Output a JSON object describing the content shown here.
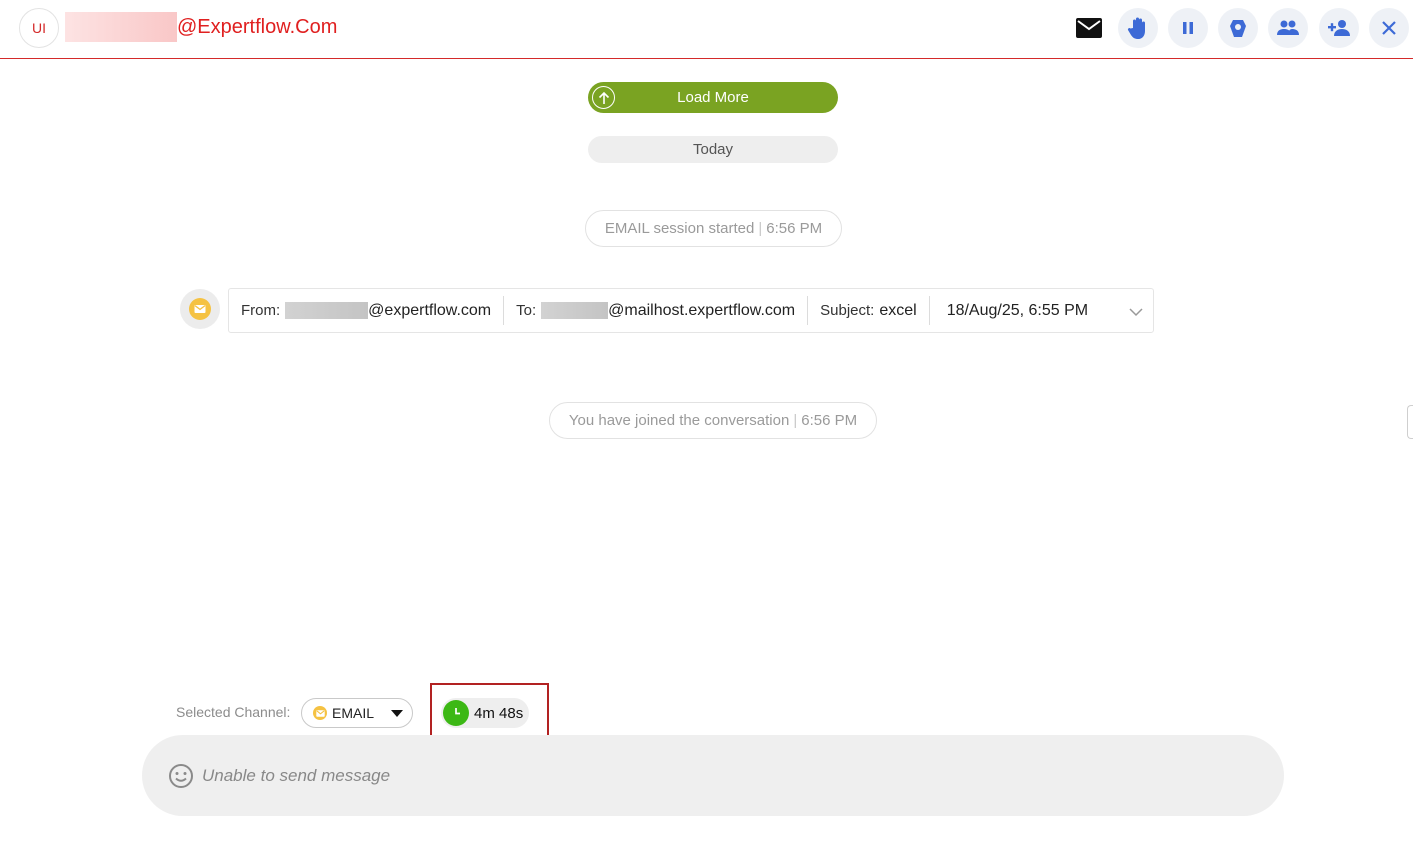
{
  "header": {
    "avatar_initials": "UI",
    "email_domain": "@Expertflow.Com",
    "icons": [
      "envelope-icon",
      "raise-hand-icon",
      "pause-icon",
      "agent-assist-icon",
      "group-icon",
      "add-person-icon",
      "close-icon"
    ],
    "accent_color": "#e02020"
  },
  "conversation": {
    "load_more_label": "Load More",
    "date_divider": "Today",
    "session_started": {
      "text": "EMAIL session started",
      "sep": "|",
      "time": "6:56 PM"
    },
    "email": {
      "from_label": "From:",
      "from_domain": "@expertflow.com",
      "to_label": "To:",
      "to_domain": "@mailhost.expertflow.com",
      "subject_label": "Subject:",
      "subject_value": "excel",
      "datetime": "18/Aug/25, 6:55 PM"
    },
    "joined": {
      "text": "You have joined the conversation",
      "sep": "|",
      "time": "6:56 PM"
    }
  },
  "footer": {
    "selected_channel_label": "Selected Channel:",
    "channel_value": "EMAIL",
    "timer": "4m 48s",
    "composer_placeholder": "Unable to send message"
  },
  "colors": {
    "load_more": "#7aa322",
    "timer_clock": "#3cb815",
    "email_badge": "#f5c242",
    "highlight_border": "#b22222"
  }
}
